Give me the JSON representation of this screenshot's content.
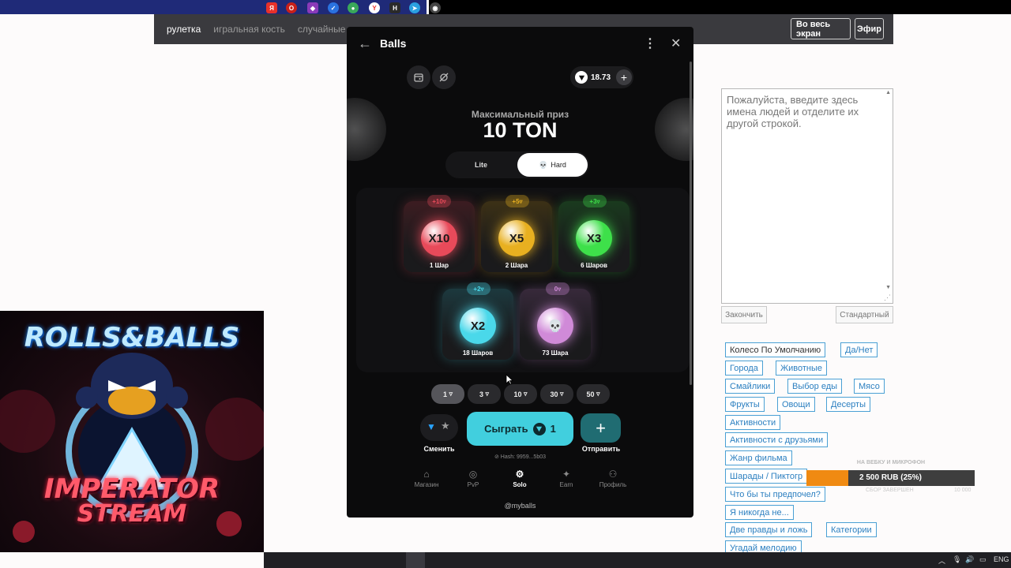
{
  "site_nav": {
    "links": [
      "рулетка",
      "игральная кость",
      "случайные числ"
    ],
    "fullscreen_label": "Во весь экран",
    "broadcast_label": "Эфир"
  },
  "app": {
    "title": "Balls",
    "balance": "18.73",
    "prize_label": "Максимальный приз",
    "prize_value": "10 TON",
    "mode_lite": "Lite",
    "mode_hard": "Hard",
    "cards": [
      {
        "mult": "X10",
        "badge": "+10",
        "count": "1 Шар",
        "color": "#e84a5a"
      },
      {
        "mult": "X5",
        "badge": "+5",
        "count": "2 Шара",
        "color": "#e8b020"
      },
      {
        "mult": "X3",
        "badge": "+3",
        "count": "6 Шаров",
        "color": "#3ee04a"
      },
      {
        "mult": "X2",
        "badge": "+2",
        "count": "18 Шаров",
        "color": "#4ad8ea"
      },
      {
        "mult": "",
        "badge": "0",
        "count": "73 Шара",
        "color": "#d08ad8"
      }
    ],
    "bets": [
      "1",
      "3",
      "10",
      "30",
      "50"
    ],
    "swap_label": "Сменить",
    "play_label": "Сыграть",
    "play_amount": "1",
    "send_label": "Отправить",
    "hash": "Hash: 9959...5b03",
    "tabs": [
      {
        "label": "Магазин",
        "icon": "shop-icon"
      },
      {
        "label": "PvP",
        "icon": "pvp-icon"
      },
      {
        "label": "Solo",
        "icon": "gear-icon"
      },
      {
        "label": "Earn",
        "icon": "earn-icon"
      },
      {
        "label": "Профиль",
        "icon": "profile-icon"
      }
    ],
    "handle": "@myballs"
  },
  "names_box": {
    "placeholder": "Пожалуйста, введите здесь имена людей и отделите их другой строкой."
  },
  "buttons": {
    "finish": "Закончить",
    "standard": "Стандартный"
  },
  "tags": [
    "Колесо По Умолчанию",
    "Да/Нет",
    "Города",
    "Животные",
    "Смайлики",
    "Выбор еды",
    "Мясо",
    "Фрукты",
    "Овощи",
    "Десерты",
    "Активности",
    "Активности с друзьями",
    "Жанр фильма",
    "Шарады / Пиктогр",
    "Что бы ты предпочел?",
    "Я никогда не...",
    "Две правды и ложь",
    "Категории",
    "Угадай мелодию"
  ],
  "donation": {
    "top_label": "НА ВЕБКУ И МИКРОФОН",
    "amount_text": "2 500 RUB (25%)",
    "progress": 0.25,
    "sub_left": "СБОР ЗАВЕРШЕН",
    "sub_right": "10 000"
  },
  "stream_art": {
    "line1": "ROLLS&BALLS",
    "line2": "IMPERATOR",
    "line3": "STREAM"
  },
  "taskbar": {
    "language": "ENG"
  },
  "colors": {
    "accent_play": "#41cfde",
    "donation_fill": "#f08a12",
    "tag_border": "#4aa0d4"
  }
}
